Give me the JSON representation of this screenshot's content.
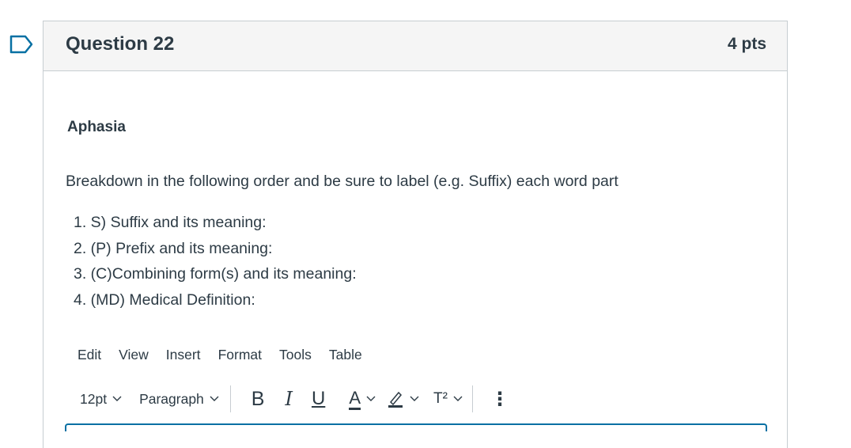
{
  "question": {
    "title": "Question 22",
    "points": "4 pts",
    "term": "Aphasia",
    "instructions": "Breakdown in the following order and be sure to label (e.g. Suffix) each word part",
    "steps": [
      "1.  S) Suffix and its meaning:",
      "2. (P) Prefix and its meaning:",
      "3. (C)Combining form(s) and its meaning:",
      "4. (MD) Medical Definition:"
    ]
  },
  "editor": {
    "menu": [
      "Edit",
      "View",
      "Insert",
      "Format",
      "Tools",
      "Table"
    ],
    "font_size": "12pt",
    "block_format": "Paragraph",
    "bold": "B",
    "italic": "I",
    "underline": "U",
    "text_color": "A",
    "superscript": "T²",
    "more": "⋮"
  },
  "colors": {
    "flag_border": "#0770a3",
    "text": "#2d3b45",
    "header_bg": "#f5f5f5",
    "border": "#c7cdd1",
    "editor_focus": "#0770a3"
  },
  "icons": [
    "flag-icon",
    "chevron-down-icon",
    "highlight-icon",
    "more-vertical-icon"
  ]
}
